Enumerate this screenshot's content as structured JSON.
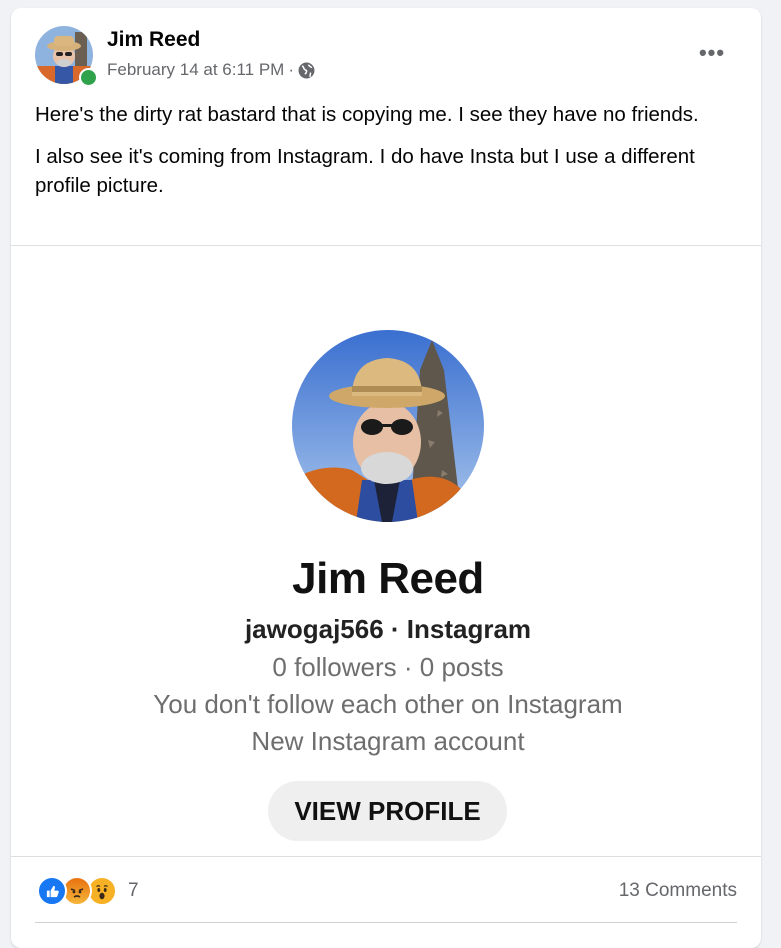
{
  "post": {
    "author": "Jim Reed",
    "timestamp": "February 14 at 6:11 PM",
    "separator": "·",
    "privacy_icon": "globe-icon",
    "more_icon": "more-options-icon",
    "more_label": "•••",
    "text_paragraphs": [
      "Here's the dirty rat bastard that is copying me. I see they have no friends.",
      "I also see it's coming from Instagram.  I do have Insta but I use a different profile picture."
    ]
  },
  "shared_card": {
    "name": "Jim Reed",
    "handle_line": "jawogaj566 · Instagram",
    "stats_line": "0 followers · 0 posts",
    "follow_line": "You don't follow each other on Instagram",
    "account_line": "New Instagram account",
    "button_label": "VIEW PROFILE"
  },
  "footer": {
    "reaction_icons": [
      "like-icon",
      "angry-icon",
      "wow-icon"
    ],
    "reaction_count": "7",
    "comments_label": "13 Comments"
  },
  "colors": {
    "online": "#31a24c",
    "like": "#1877f2",
    "meta_text": "#65676b"
  }
}
